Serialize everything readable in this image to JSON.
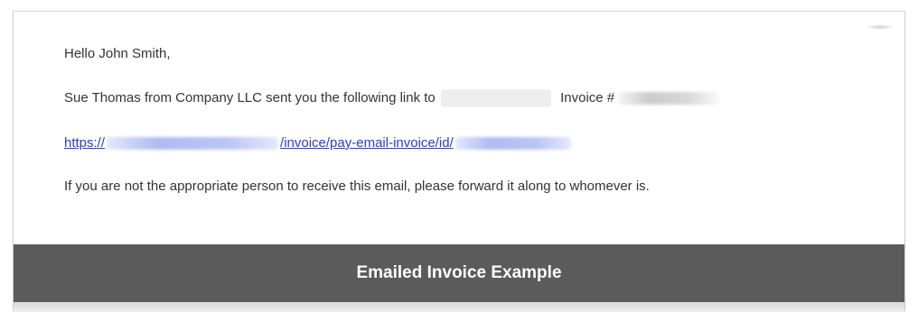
{
  "email": {
    "greeting": "Hello John Smith,",
    "sender_line_before": "Sue Thomas from Company LLC sent you the following link to",
    "sender_line_after": "Invoice #",
    "link": {
      "prefix": "https://",
      "path": "/invoice/pay-email-invoice/id/"
    },
    "notice": "If you are not the appropriate person to receive this email, please forward it along to whomever is."
  },
  "caption": {
    "title": "Emailed Invoice Example"
  },
  "colors": {
    "link": "#2a3bd6",
    "text": "#333333",
    "caption_bg": "#5b5b5b"
  }
}
